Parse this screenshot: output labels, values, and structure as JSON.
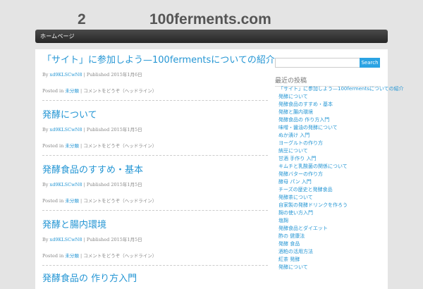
{
  "header": {
    "number": "2",
    "site_name": "100ferments.com"
  },
  "nav": {
    "items": [
      "ホームページ"
    ]
  },
  "posts": [
    {
      "title": "「サイト」に参加しよう—100fermentsについての紹介",
      "by": "By",
      "author": "xd9KLSCwN8",
      "published_label": "| Published",
      "date": "2015年1月6日",
      "posted_in": "Posted in",
      "category": "未分類",
      "comments": "| コメントをどうぞ（ヘッドライン）"
    },
    {
      "title": "発酵について",
      "by": "By",
      "author": "xd9KLSCwN8",
      "published_label": "| Published",
      "date": "2015年1月5日",
      "posted_in": "Posted in",
      "category": "未分類",
      "comments": "| コメントをどうぞ（ヘッドライン）"
    },
    {
      "title": "発酵食品のすすめ・基本",
      "by": "By",
      "author": "xd9KLSCwN8",
      "published_label": "| Published",
      "date": "2015年1月5日",
      "posted_in": "Posted in",
      "category": "未分類",
      "comments": "| コメントをどうぞ（ヘッドライン）"
    },
    {
      "title": "発酵と腸内環境",
      "by": "By",
      "author": "xd9KLSCwN8",
      "published_label": "| Published",
      "date": "2015年1月5日",
      "posted_in": "Posted in",
      "category": "未分類",
      "comments": "| コメントをどうぞ（ヘッドライン）"
    },
    {
      "title": "発酵食品の 作り方入門"
    }
  ],
  "sidebar": {
    "search_placeholder": "",
    "search_button": "Search",
    "widget_title": "最近の投稿",
    "recent_posts": [
      "「サイト」に参加しよう—100fermentsについての紹介",
      "発酵について",
      "発酵食品のすすめ・基本",
      "発酵と腸内環境",
      "発酵食品の 作り方入門",
      "味噌・醤油の発酵について",
      "ぬか漬け 入門",
      "ヨーグルトの作り方",
      "納豆について",
      "甘酒 手作り 入門",
      "キムチと乳酸菌の関係について",
      "発酵バターの作り方",
      "酵母 パン 入門",
      "チーズの歴史と発酵食品",
      "発酵茶について",
      "自家製の発酵ドリンクを作ろう",
      "麹の使い方入門",
      "塩麹",
      "発酵食品とダイエット",
      "酢の 健康法",
      "発酵 食品",
      "酒粕の活用方法",
      "紅茶 発酵",
      "発酵について"
    ]
  },
  "colors": {
    "link": "#2596d4",
    "search_button": "#2ba3e3",
    "navbar": "#333333"
  }
}
